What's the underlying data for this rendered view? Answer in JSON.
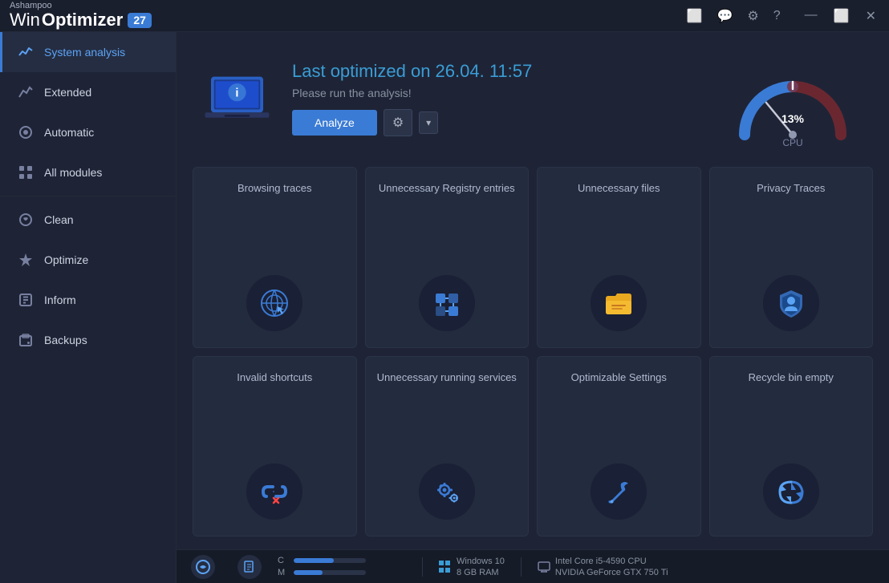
{
  "titlebar": {
    "company": "Ashampoo",
    "appname_win": "Win",
    "appname_optimizer": "Optimizer",
    "version": "27"
  },
  "sidebar": {
    "items": [
      {
        "id": "system-analysis",
        "label": "System analysis",
        "icon": "📊",
        "active": true
      },
      {
        "id": "extended",
        "label": "Extended",
        "icon": "📈",
        "active": false
      },
      {
        "id": "automatic",
        "label": "Automatic",
        "icon": "⭕",
        "active": false
      },
      {
        "id": "all-modules",
        "label": "All modules",
        "icon": "⠿",
        "active": false
      },
      {
        "id": "clean",
        "label": "Clean",
        "icon": "🧹",
        "active": false
      },
      {
        "id": "optimize",
        "label": "Optimize",
        "icon": "⚡",
        "active": false
      },
      {
        "id": "inform",
        "label": "Inform",
        "icon": "📋",
        "active": false
      },
      {
        "id": "backups",
        "label": "Backups",
        "icon": "💾",
        "active": false
      }
    ]
  },
  "header": {
    "last_optimized": "Last optimized on 26.04. 11:57",
    "subtitle": "Please run the analysis!",
    "analyze_btn": "Analyze"
  },
  "gauge": {
    "value": 13,
    "label": "CPU",
    "color_low": "#3a7bd5",
    "color_high": "#cc3333"
  },
  "cards": [
    {
      "id": "browsing-traces",
      "label": "Browsing traces",
      "icon": "🌐"
    },
    {
      "id": "unnecessary-registry",
      "label": "Unnecessary Registry entries",
      "icon": "🔷"
    },
    {
      "id": "unnecessary-files",
      "label": "Unnecessary files",
      "icon": "📁"
    },
    {
      "id": "privacy-traces",
      "label": "Privacy Traces",
      "icon": "🛡"
    },
    {
      "id": "invalid-shortcuts",
      "label": "Invalid shortcuts",
      "icon": "🔗"
    },
    {
      "id": "unnecessary-running-services",
      "label": "Unnecessary running services",
      "icon": "⚙"
    },
    {
      "id": "optimizable-settings",
      "label": "Optimizable Settings",
      "icon": "🔧"
    },
    {
      "id": "recycle-bin-empty",
      "label": "Recycle bin empty",
      "icon": "♻"
    }
  ],
  "statusbar": {
    "cpu_label": "C",
    "mem_label": "M",
    "cpu_percent": 55,
    "mem_percent": 40,
    "os": "Windows 10",
    "ram": "8 GB RAM",
    "cpu": "Intel Core i5-4590 CPU",
    "gpu": "NVIDIA GeForce GTX 750 Ti"
  }
}
